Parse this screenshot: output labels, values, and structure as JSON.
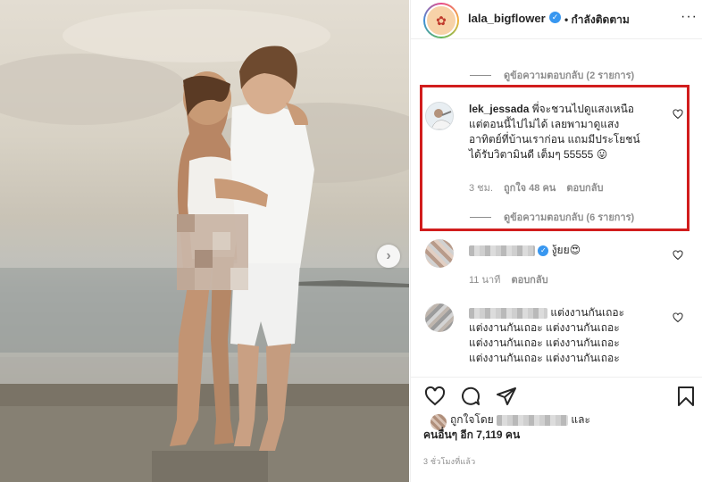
{
  "post": {
    "username": "lala_bigflower",
    "follow_status": "• กำลังติดตาม",
    "more_glyph": "···",
    "next_glyph": "›"
  },
  "comments": {
    "top_view_replies": "ดูข้อความตอบกลับ (2 รายการ)",
    "highlighted": {
      "username": "lek_jessada",
      "text_line1": "พี่จะชวนไปดูแสงเหนือ",
      "text_line2": "แต่ตอนนี้ไปไม่ได้ เลยพามาดูแสง",
      "text_line3": "อาทิตย์ที่บ้านเราก่อน แถมมีประโยชน์",
      "text_line4": "ได้รับวิตามินดี เต็มๆ 55555 😛",
      "time": "3 ชม.",
      "likes": "ถูกใจ 48 คน",
      "reply": "ตอบกลับ",
      "view_replies": "ดูข้อความตอบกลับ (6 รายการ)"
    },
    "second": {
      "text": "งู้ยย😍",
      "time": "11 นาที",
      "reply": "ตอบกลับ"
    },
    "third": {
      "line1": "แต่งงานกันเถอะ",
      "line2": "แต่งงานกันเถอะ แต่งงานกันเถอะ",
      "line3": "แต่งงานกันเถอะ แต่งงานกันเถอะ",
      "line4": "แต่งงานกันเถอะ แต่งงานกันเถอะ"
    }
  },
  "likes": {
    "prefix": "ถูกใจโดย",
    "and": "และ",
    "others": "คนอื่นๆ อีก 7,119 คน"
  },
  "timestamp": "3 ชั่วโมงที่แล้ว",
  "icons": {
    "like": "heart-icon",
    "comment": "comment-icon",
    "share": "share-icon",
    "save": "bookmark-icon"
  },
  "colors": {
    "highlight_border": "#d11d1d",
    "verified": "#3897f0",
    "muted": "#8e8e8e"
  }
}
